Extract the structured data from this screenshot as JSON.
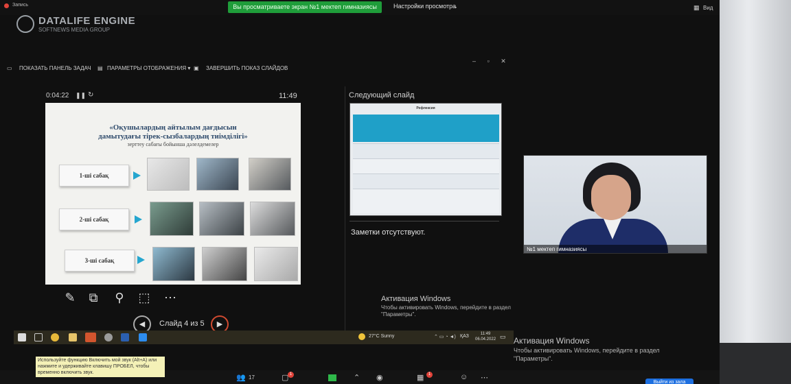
{
  "zoom": {
    "recording_title": "Запись",
    "share_banner": "Вы просматриваете экран №1 мектеп гимназиясы",
    "view_settings": "Настройки просмотра",
    "view_label": "Вид"
  },
  "watermark": {
    "title": "DATALIFE ENGINE",
    "subtitle": "SOFTNEWS MEDIA GROUP"
  },
  "presenter": {
    "toolbar": {
      "show_taskbar": "ПОКАЗАТЬ ПАНЕЛЬ ЗАДАЧ",
      "display_settings": "ПАРАМЕТРЫ ОТОБРАЖЕНИЯ ▾",
      "end_show": "ЗАВЕРШИТЬ ПОКАЗ СЛАЙДОВ"
    },
    "window_controls": "– ▫ ✕",
    "elapsed_time": "0:04:22",
    "clock": "11:49",
    "next_slide_label": "Следующий слайд",
    "notes_text": "Заметки отсутствуют.",
    "slide_counter": "Слайд 4 из 5",
    "current_slide": {
      "title": "«Оқушылардың айтылым дағдысын дамытудағы тірек-сызбалардың тиімділігі»",
      "subtitle": "зерттеу сабағы бойынша дәлелдемелер",
      "lessons": [
        "1-ші сабақ",
        "2-ші сабақ",
        "3-ші сабақ"
      ]
    },
    "next_slide": {
      "title": "Рефлексия"
    }
  },
  "activation_inner": {
    "title": "Активация Windows",
    "text": "Чтобы активировать Windows, перейдите в раздел \"Параметры\"."
  },
  "activation_outer": {
    "title": "Активация Windows",
    "text": "Чтобы активировать Windows, перейдите в раздел \"Параметры\"."
  },
  "taskbar": {
    "weather": "27°C  Sunny",
    "language": "ҚАЗ",
    "time": "11:49",
    "date": "06.04.2022"
  },
  "webcam": {
    "participant_name": "№1 мектеп гимназиясы"
  },
  "tooltip": {
    "text": "Используйте функцию Включить мой звук (Alt+A) или нажмите и удерживайте клавишу ПРОБЕЛ, чтобы временно включить звук."
  },
  "bottom_bar": {
    "participants_count": "17",
    "chat_badge": "1",
    "reactions_badge": "1",
    "leave_label": "Выйти из зала"
  },
  "colors": {
    "share_green": "#1f9d3a",
    "slide_accent": "#25a6cf",
    "leave_blue": "#1d6fe0"
  }
}
